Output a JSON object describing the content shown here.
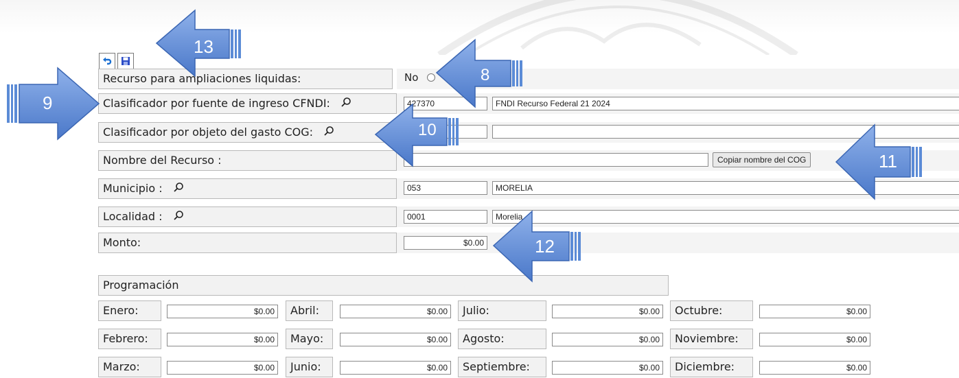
{
  "toolbar": {
    "undo_icon": "undo-icon",
    "save_icon": "save-icon"
  },
  "form": {
    "ampliaciones_label": "Recurso para ampliaciones liquidas:",
    "ampliaciones_value": "No",
    "cfndi_label": "Clasificador por fuente de ingreso CFNDI:",
    "cfndi_code": "427370",
    "cfndi_desc": "FNDI Recurso Federal 21 2024",
    "cog_label": "Clasificador por objeto del gasto COG:",
    "cog_code": "",
    "cog_desc": "",
    "nombre_label": "Nombre del Recurso :",
    "nombre_value": "",
    "copiar_button": "Copiar nombre del COG",
    "municipio_label": "Municipio :",
    "municipio_code": "053",
    "municipio_desc": "MORELIA",
    "localidad_label": "Localidad :",
    "localidad_code": "0001",
    "localidad_desc": "Morelia",
    "monto_label": "Monto:",
    "monto_value": "$0.00"
  },
  "programacion": {
    "title": "Programación",
    "months": [
      {
        "label": "Enero:",
        "value": "$0.00"
      },
      {
        "label": "Febrero:",
        "value": "$0.00"
      },
      {
        "label": "Marzo:",
        "value": "$0.00"
      },
      {
        "label": "Abril:",
        "value": "$0.00"
      },
      {
        "label": "Mayo:",
        "value": "$0.00"
      },
      {
        "label": "Junio:",
        "value": "$0.00"
      },
      {
        "label": "Julio:",
        "value": "$0.00"
      },
      {
        "label": "Agosto:",
        "value": "$0.00"
      },
      {
        "label": "Septiembre:",
        "value": "$0.00"
      },
      {
        "label": "Octubre:",
        "value": "$0.00"
      },
      {
        "label": "Noviembre:",
        "value": "$0.00"
      },
      {
        "label": "Diciembre:",
        "value": "$0.00"
      }
    ]
  },
  "callouts": {
    "c8": "8",
    "c9": "9",
    "c10": "10",
    "c11": "11",
    "c12": "12",
    "c13": "13",
    "color": "#5b8bd6"
  }
}
